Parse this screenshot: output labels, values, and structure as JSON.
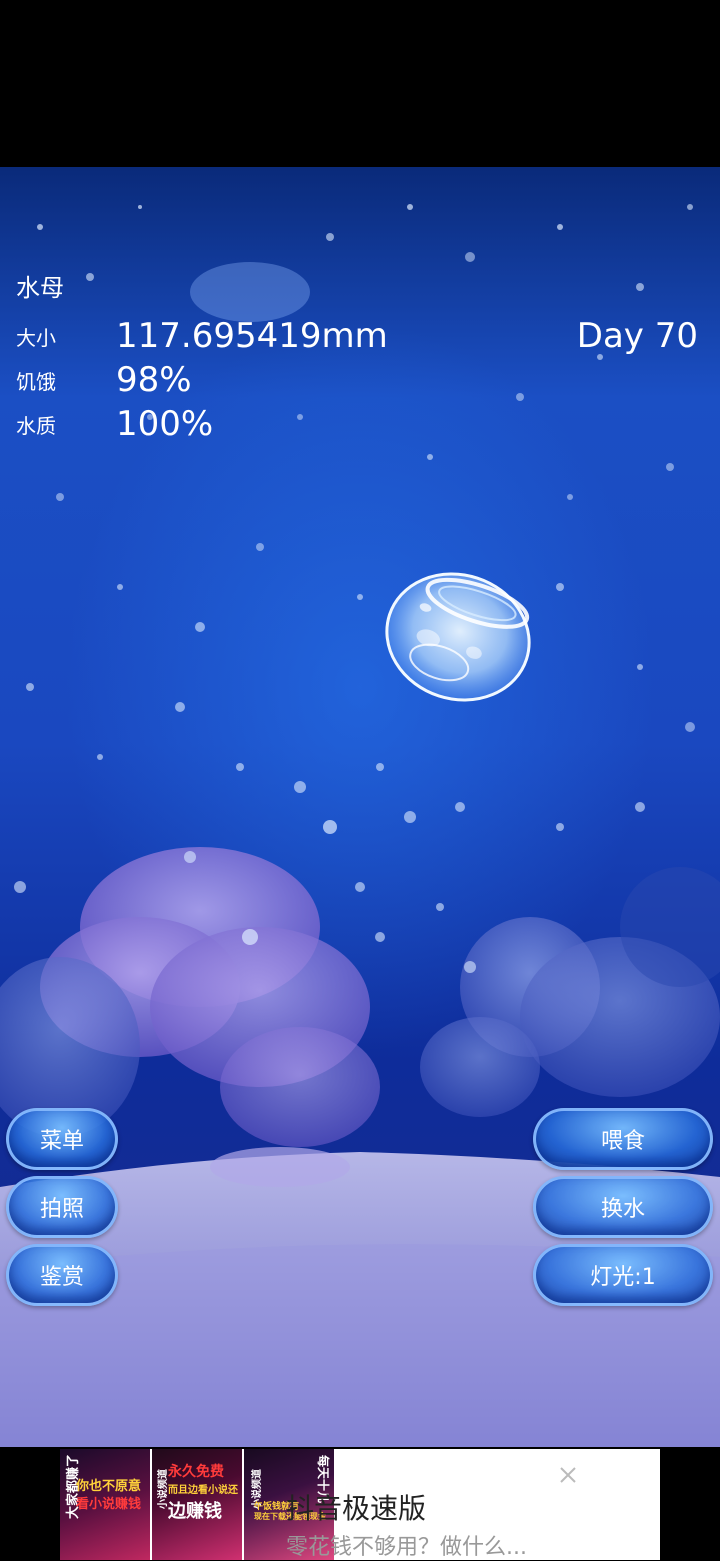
{
  "stats": {
    "title": "水母",
    "size_label": "大小",
    "size_value": "117.695419mm",
    "hunger_label": "饥饿",
    "hunger_value": "98%",
    "water_label": "水质",
    "water_value": "100%",
    "day": "Day 70"
  },
  "buttons": {
    "menu": "菜单",
    "photo": "拍照",
    "appreciate": "鉴赏",
    "feed": "喂食",
    "change_water": "换水",
    "light": "灯光:1"
  },
  "ad": {
    "thumb1_a": "大家都赚了",
    "thumb1_b": "你也不原意",
    "thumb1_c": "看小说赚钱",
    "thumb2_a": "小说频道",
    "thumb2_b": "永久免费",
    "thumb2_c": "而且边看小说还",
    "thumb2_d": "边赚钱",
    "thumb3_a": "小说频道",
    "thumb3_b": "每天十几",
    "thumb3_c": "午饭钱就有",
    "thumb3_d": "现在下载还能领现金",
    "title": "抖音极速版",
    "subtitle": "零花钱不够用？做什么..."
  }
}
